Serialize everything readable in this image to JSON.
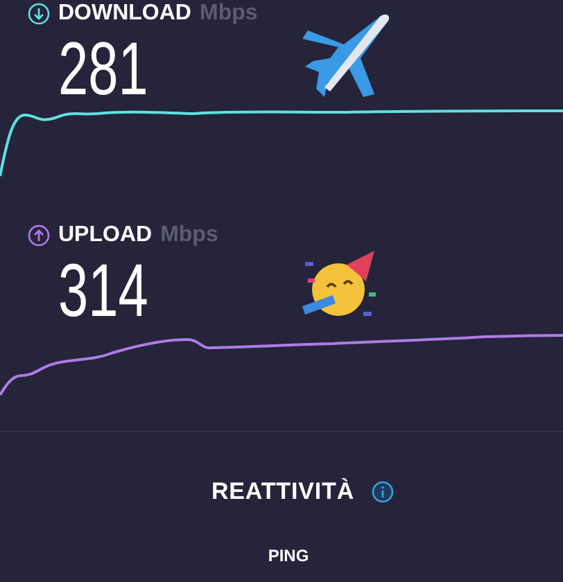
{
  "metrics": [
    {
      "kind": "download",
      "label": "DOWNLOAD",
      "unit": "Mbps",
      "value": "281",
      "color": "#5fe0e0"
    },
    {
      "kind": "upload",
      "label": "UPLOAD",
      "unit": "Mbps",
      "value": "314",
      "color": "#b07be8"
    }
  ],
  "responsiveness": {
    "title": "REATTIVITÀ",
    "sub": "PING"
  }
}
